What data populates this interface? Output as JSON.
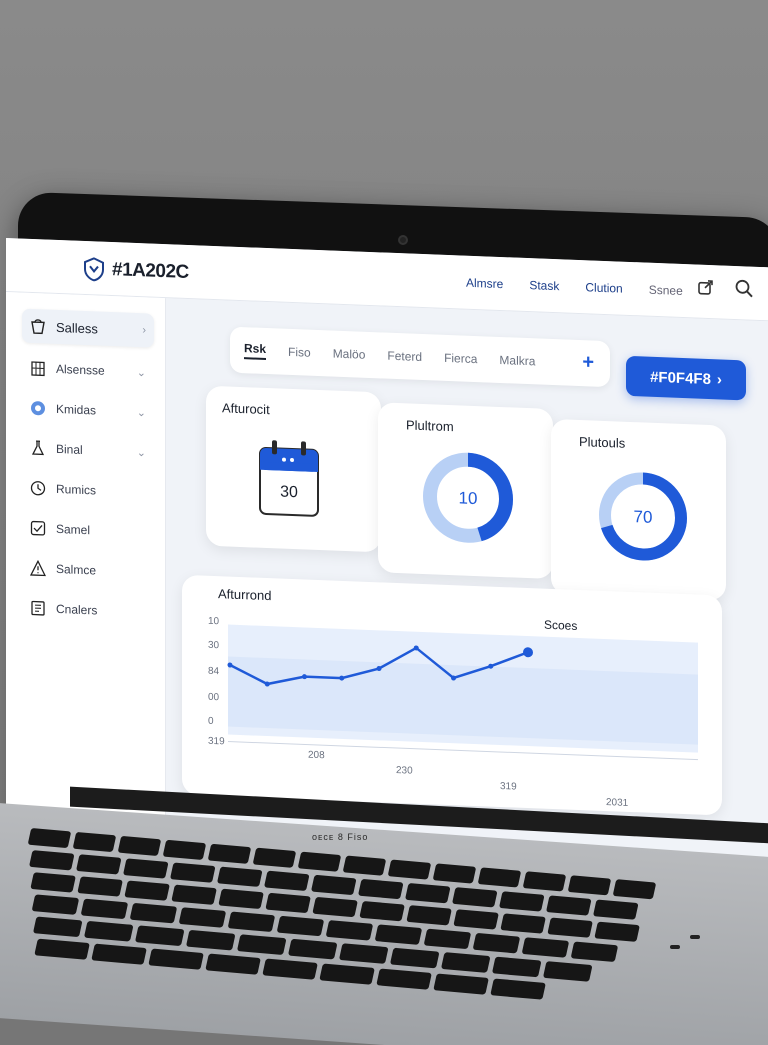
{
  "app": {
    "brand": "#1A202C"
  },
  "topnav": {
    "items": [
      "Almsre",
      "Stask",
      "Clution",
      "Ssnee"
    ]
  },
  "sidebar": {
    "items": [
      {
        "label": "Salless",
        "icon": "bucket-icon",
        "active": true
      },
      {
        "label": "Alsensse",
        "icon": "building-icon"
      },
      {
        "label": "Kmidas",
        "icon": "circle-icon"
      },
      {
        "label": "Binal",
        "icon": "flask-icon"
      },
      {
        "label": "Rumics",
        "icon": "clock-icon"
      },
      {
        "label": "Samel",
        "icon": "check-box-icon"
      },
      {
        "label": "Salmce",
        "icon": "warning-icon"
      },
      {
        "label": "Cnalers",
        "icon": "document-icon"
      }
    ]
  },
  "tabs": {
    "items": [
      "Rsk",
      "Fiso",
      "Malöo",
      "Feterd",
      "Fierca",
      "Malkra"
    ],
    "active": "Rsk",
    "add_label": "+"
  },
  "cta": {
    "label": "#F0F4F8",
    "chevron": "›"
  },
  "cards": {
    "calendar": {
      "title": "Afturocit",
      "value": "30"
    },
    "donut1": {
      "title": "Plultrom",
      "value": "10",
      "percent": 0.45
    },
    "donut2": {
      "title": "Plutouls",
      "value": "70",
      "percent": 0.7
    }
  },
  "chart_data": {
    "type": "line",
    "title": "Afturrond",
    "y_ticks": [
      "10",
      "30",
      "84",
      "00",
      "0",
      "319"
    ],
    "x_ticks": [
      "208",
      "230",
      "319",
      "2031"
    ],
    "series": [
      {
        "name": "Scoes",
        "values": [
          56,
          40,
          48,
          48,
          58,
          78,
          52,
          64,
          78
        ]
      }
    ],
    "ylim": [
      0,
      100
    ],
    "grid": false,
    "legend_position": "top-right"
  },
  "laptop": {
    "model_text": "ᴏᴇᴄᴇ 8 Fiso"
  },
  "colors": {
    "accent": "#1F5AD8",
    "light_accent": "#B8D0F5",
    "text": "#1A202C",
    "page_bg": "#F0F4F8"
  }
}
